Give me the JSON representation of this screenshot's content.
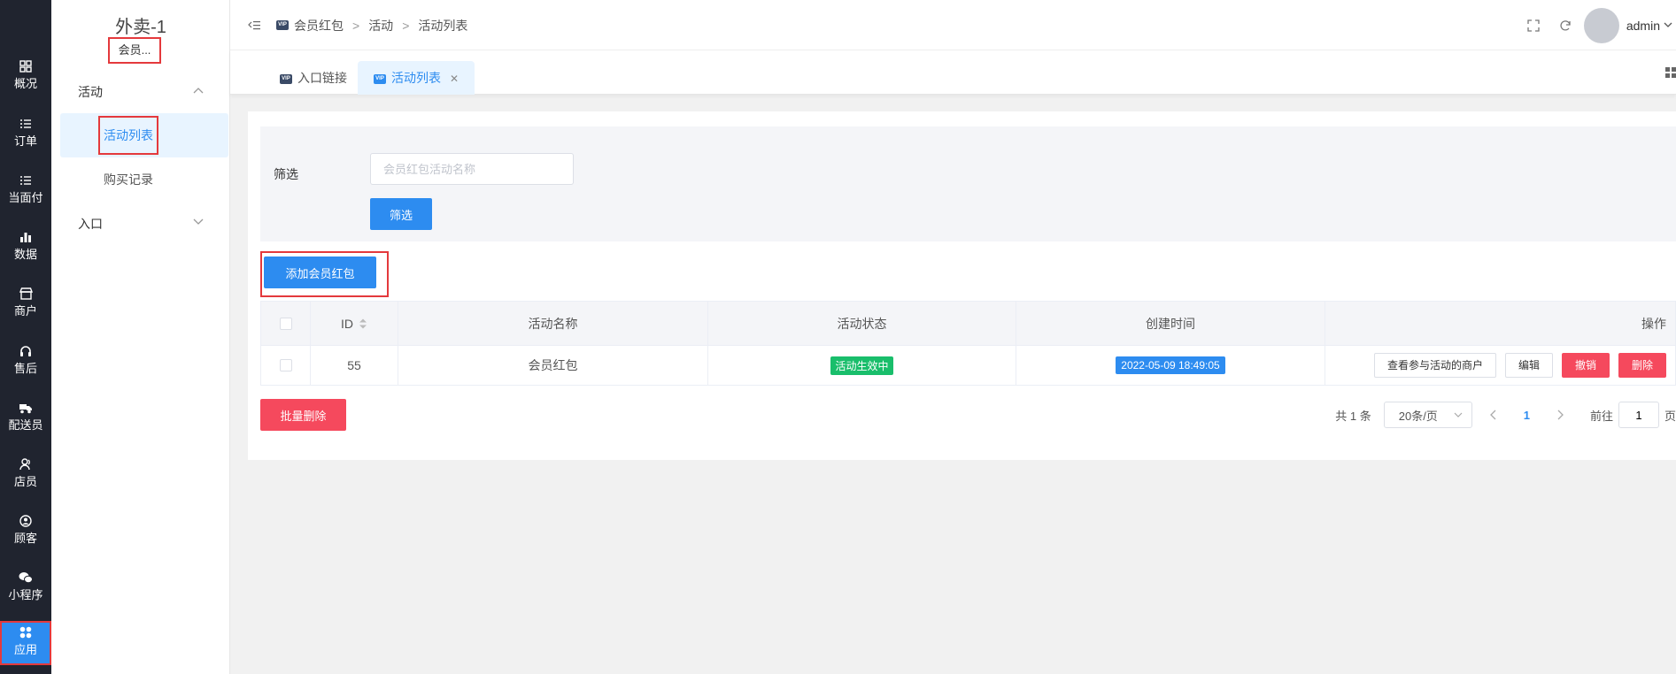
{
  "rail": [
    {
      "label": "概况",
      "icon": "dashboard-icon"
    },
    {
      "label": "订单",
      "icon": "list-icon"
    },
    {
      "label": "当面付",
      "icon": "list-icon"
    },
    {
      "label": "数据",
      "icon": "bar-chart-icon"
    },
    {
      "label": "商户",
      "icon": "store-icon"
    },
    {
      "label": "售后",
      "icon": "headset-icon"
    },
    {
      "label": "配送员",
      "icon": "delivery-icon"
    },
    {
      "label": "店员",
      "icon": "staff-icon"
    },
    {
      "label": "顾客",
      "icon": "customer-icon"
    },
    {
      "label": "小程序",
      "icon": "wechat-icon"
    },
    {
      "label": "应用",
      "icon": "apps-icon"
    }
  ],
  "submenu": {
    "store_name": "外卖-1",
    "store_tag": "会员...",
    "group1": "活动",
    "item_active": "活动列表",
    "item2": "购买记录",
    "group2": "入口"
  },
  "header": {
    "breadcrumb": [
      "会员红包",
      "活动",
      "活动列表"
    ],
    "admin": "admin"
  },
  "tabs": [
    {
      "label": "入口链接"
    },
    {
      "label": "活动列表"
    }
  ],
  "filter": {
    "label": "筛选",
    "placeholder": "会员红包活动名称",
    "button": "筛选"
  },
  "add_button": "添加会员红包",
  "table": {
    "headers": [
      "ID",
      "活动名称",
      "活动状态",
      "创建时间",
      "操作"
    ],
    "rows": [
      {
        "id": "55",
        "name": "会员红包",
        "status": "活动生效中",
        "created": "2022-05-09 18:49:05"
      }
    ],
    "ops": [
      "查看参与活动的商户",
      "编辑",
      "撤销",
      "删除"
    ]
  },
  "batch_delete": "批量删除",
  "pager": {
    "total": "共 1 条",
    "size": "20条/页",
    "current": "1",
    "goto": "前往",
    "goto_value": "1",
    "page_unit": "页"
  },
  "colors": {
    "primary": "#2d8cf0",
    "danger": "#f5495d",
    "success": "#19be6b",
    "rail_bg": "#20242f",
    "highlight": "#e4393c"
  }
}
